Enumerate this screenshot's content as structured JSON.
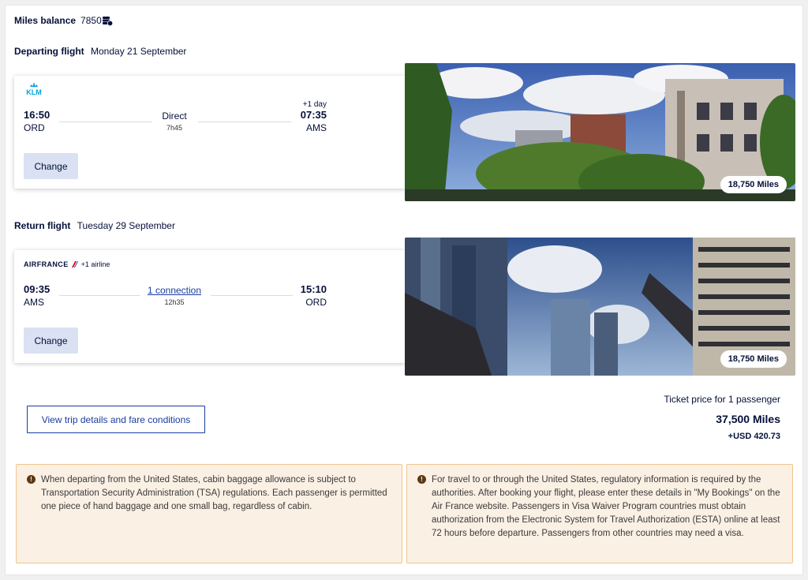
{
  "miles_balance": {
    "label": "Miles balance",
    "value": "7850",
    "icon": "miles-coin-icon"
  },
  "outbound": {
    "section_label": "Departing flight",
    "date": "Monday 21 September",
    "airline": "KLM",
    "airline_extra": "",
    "departure_time": "16:50",
    "departure_airport": "ORD",
    "arrival_time": "07:35",
    "arrival_airport": "AMS",
    "day_offset": "+1 day",
    "stops_label": "Direct",
    "duration": "7h45",
    "change_label": "Change",
    "miles_badge": "18,750 Miles"
  },
  "return": {
    "section_label": "Return flight",
    "date": "Tuesday 29 September",
    "airline": "AIRFRANCE",
    "airline_extra": "+1 airline",
    "departure_time": "09:35",
    "departure_airport": "AMS",
    "arrival_time": "15:10",
    "arrival_airport": "ORD",
    "stops_label": "1 connection",
    "duration": "12h35",
    "change_label": "Change",
    "miles_badge": "18,750 Miles"
  },
  "trip_details_button": "View trip details and fare conditions",
  "price": {
    "label": "Ticket price for 1 passenger",
    "miles": "37,500 Miles",
    "usd": "+USD 420.73"
  },
  "notices": [
    {
      "icon": "!",
      "text": "When departing from the United States, cabin baggage allowance is subject to Transportation Security Administration (TSA) regulations. Each passenger is permitted one piece of hand baggage and one small bag, regardless of cabin."
    },
    {
      "icon": "!",
      "text": "For travel to or through the United States, regulatory information is required by the authorities. After booking your flight, please enter these details in \"My Bookings\" on the Air France website. Passengers in Visa Waiver Program countries must obtain authorization from the Electronic System for Travel Authorization (ESTA) online at least 72 hours before departure. Passengers from other countries may need a visa."
    }
  ],
  "colors": {
    "brand_navy": "#051039",
    "link_blue": "#1a3c9e",
    "button_bg": "#d9e1f2",
    "notice_bg": "#fbf0e4",
    "notice_border": "#f0c58f",
    "klm_blue": "#00a1de",
    "airfrance_red": "#e2001a"
  }
}
